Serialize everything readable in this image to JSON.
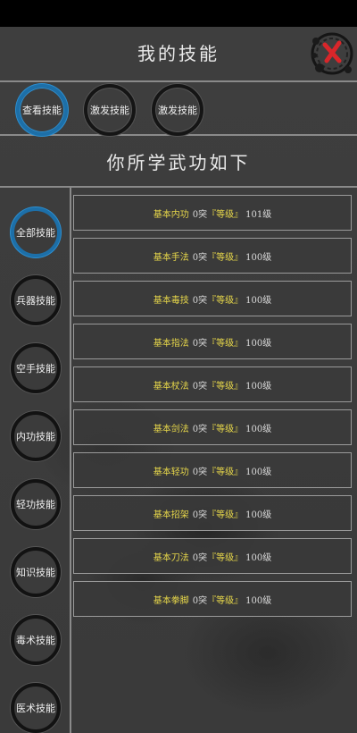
{
  "header": {
    "title": "我的技能"
  },
  "tabs": [
    {
      "label": "查看技能",
      "active": true
    },
    {
      "label": "激发技能",
      "active": false
    },
    {
      "label": "激发技能",
      "active": false
    }
  ],
  "subtitle": "你所学武功如下",
  "categories": [
    {
      "label": "全部技能",
      "active": true
    },
    {
      "label": "兵器技能",
      "active": false
    },
    {
      "label": "空手技能",
      "active": false
    },
    {
      "label": "内功技能",
      "active": false
    },
    {
      "label": "轻功技能",
      "active": false
    },
    {
      "label": "知识技能",
      "active": false
    },
    {
      "label": "毒术技能",
      "active": false
    },
    {
      "label": "医术技能",
      "active": false
    }
  ],
  "skills": [
    {
      "name": "基本内功",
      "tu": "0突",
      "grade": "『等级』",
      "level": "101级"
    },
    {
      "name": "基本手法",
      "tu": "0突",
      "grade": "『等级』",
      "level": "100级"
    },
    {
      "name": "基本毒技",
      "tu": "0突",
      "grade": "『等级』",
      "level": "100级"
    },
    {
      "name": "基本指法",
      "tu": "0突",
      "grade": "『等级』",
      "level": "100级"
    },
    {
      "name": "基本杖法",
      "tu": "0突",
      "grade": "『等级』",
      "level": "100级"
    },
    {
      "name": "基本剑法",
      "tu": "0突",
      "grade": "『等级』",
      "level": "100级"
    },
    {
      "name": "基本轻功",
      "tu": "0突",
      "grade": "『等级』",
      "level": "100级"
    },
    {
      "name": "基本招架",
      "tu": "0突",
      "grade": "『等级』",
      "level": "100级"
    },
    {
      "name": "基本刀法",
      "tu": "0突",
      "grade": "『等级』",
      "level": "100级"
    },
    {
      "name": "基本拳脚",
      "tu": "0突",
      "grade": "『等级』",
      "level": "100级"
    }
  ],
  "colors": {
    "accent_blue": "#1d6fa8",
    "skill_name": "#e8d84a",
    "close_red": "#d8262a"
  },
  "icons": {
    "close": "close-x-icon"
  }
}
